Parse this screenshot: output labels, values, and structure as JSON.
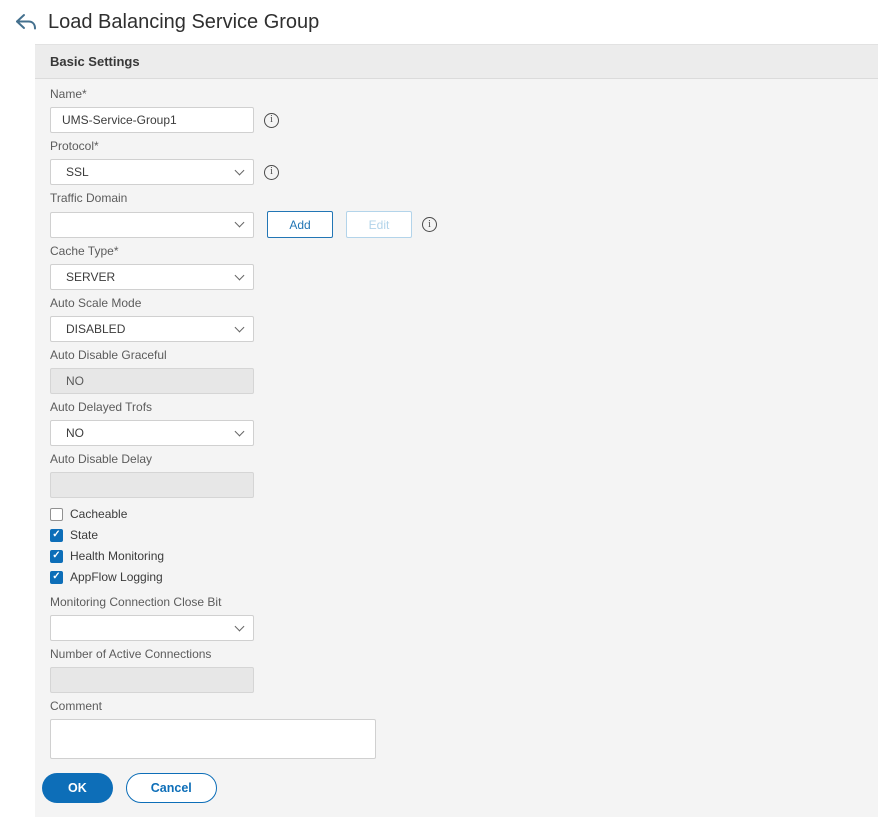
{
  "header": {
    "title": "Load Balancing Service Group"
  },
  "panel": {
    "title": "Basic Settings"
  },
  "form": {
    "name": {
      "label": "Name*",
      "value": "UMS-Service-Group1"
    },
    "protocol": {
      "label": "Protocol*",
      "value": "SSL"
    },
    "traffic_domain": {
      "label": "Traffic Domain",
      "value": "",
      "add": "Add",
      "edit": "Edit"
    },
    "cache_type": {
      "label": "Cache Type*",
      "value": "SERVER"
    },
    "auto_scale_mode": {
      "label": "Auto Scale Mode",
      "value": "DISABLED"
    },
    "auto_disable_graceful": {
      "label": "Auto Disable Graceful",
      "value": "NO"
    },
    "auto_delayed_trofs": {
      "label": "Auto Delayed Trofs",
      "value": "NO"
    },
    "auto_disable_delay": {
      "label": "Auto Disable Delay",
      "value": ""
    },
    "monitoring_close_bit": {
      "label": "Monitoring Connection Close Bit",
      "value": ""
    },
    "active_connections": {
      "label": "Number of Active Connections",
      "value": ""
    },
    "comment": {
      "label": "Comment",
      "value": ""
    }
  },
  "checkboxes": {
    "cacheable": {
      "label": "Cacheable",
      "checked": false
    },
    "state": {
      "label": "State",
      "checked": true
    },
    "health_monitoring": {
      "label": "Health Monitoring",
      "checked": true
    },
    "appflow_logging": {
      "label": "AppFlow Logging",
      "checked": true
    }
  },
  "actions": {
    "ok": "OK",
    "cancel": "Cancel"
  },
  "icons": {
    "info": "i",
    "check": "✓"
  },
  "colors": {
    "accent": "#0d6eb8",
    "accent_disabled": "#b3d4ea",
    "panel_bg": "#f4f4f4",
    "panel_header_bg": "#ececec"
  }
}
